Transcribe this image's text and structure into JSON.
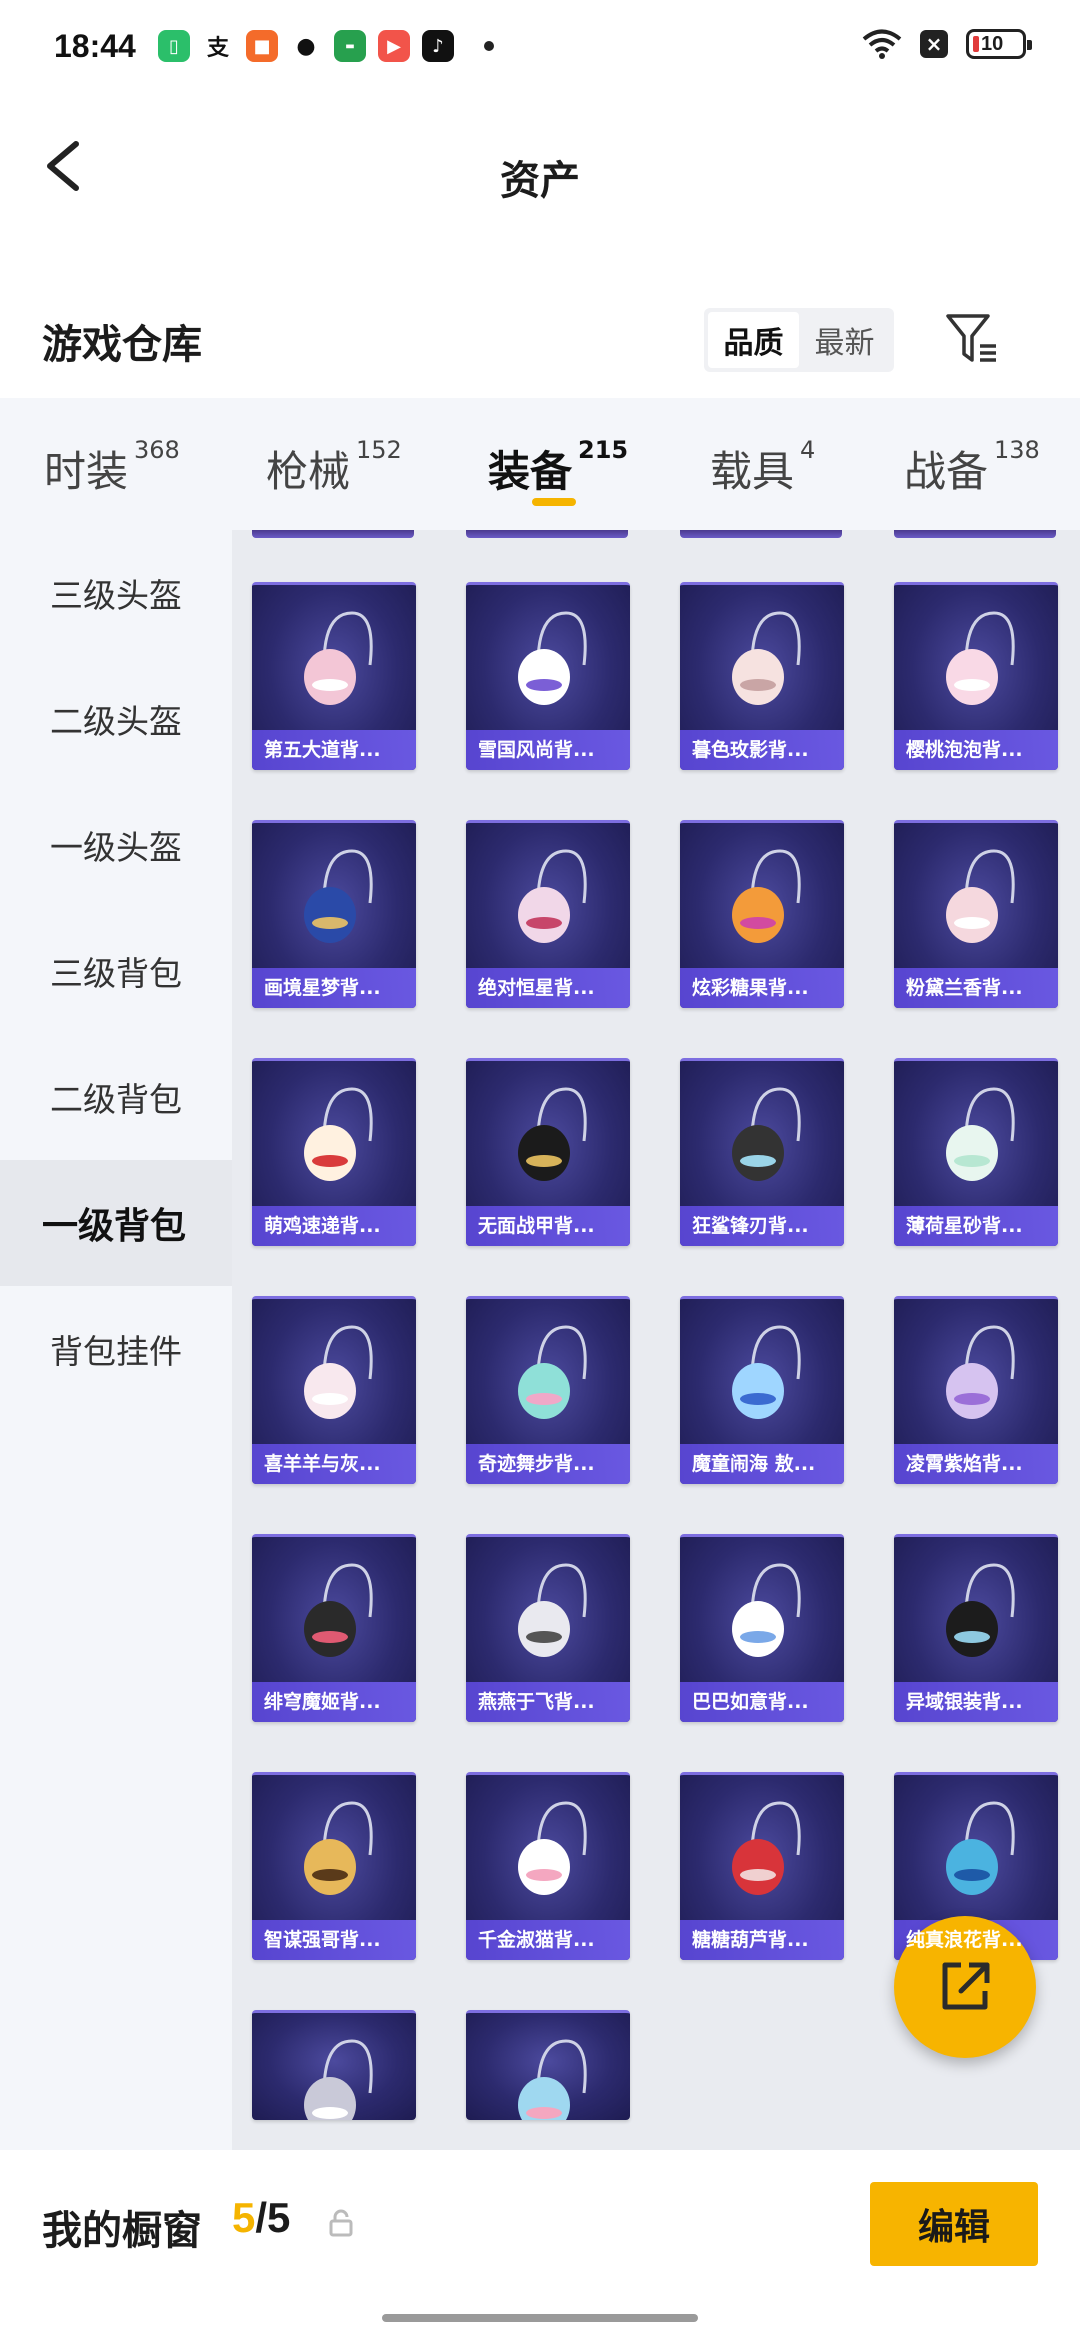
{
  "status_bar": {
    "time": "18:44",
    "battery": "10",
    "apps": [
      "wallet-app",
      "alipay-app",
      "game-app",
      "wechat-app",
      "oppo-app",
      "video-app",
      "tiktok-app"
    ]
  },
  "nav": {
    "title": "资产"
  },
  "warehouse": {
    "title": "游戏仓库",
    "sort_options": [
      "品质",
      "最新"
    ],
    "active_sort": "品质"
  },
  "tabs": [
    {
      "label": "时装",
      "count": "368"
    },
    {
      "label": "枪械",
      "count": "152"
    },
    {
      "label": "装备",
      "count": "215"
    },
    {
      "label": "载具",
      "count": "4"
    },
    {
      "label": "战备",
      "count": "138"
    }
  ],
  "active_tab": "装备",
  "sidebar": [
    "三级头盔",
    "二级头盔",
    "一级头盔",
    "三级背包",
    "二级背包",
    "一级背包",
    "背包挂件"
  ],
  "active_sidebar": "一级背包",
  "items": [
    "第五大道背...",
    "雪国风尚背...",
    "暮色玫影背...",
    "樱桃泡泡背...",
    "画境星梦背...",
    "绝对恒星背...",
    "炫彩糖果背...",
    "粉黛兰香背...",
    "萌鸡速递背...",
    "无面战甲背...",
    "狂鲨锋刃背...",
    "薄荷星砂背...",
    "喜羊羊与灰...",
    "奇迹舞步背...",
    "魔童闹海 敖...",
    "凌霄紫焰背...",
    "绯穹魔姬背...",
    "燕燕于飞背...",
    "巴巴如意背...",
    "异域银装背...",
    "智谋强哥背...",
    "千金淑猫背...",
    "糖糖葫芦背...",
    "纯真浪花背...",
    "",
    ""
  ],
  "bottom_bar": {
    "title": "我的橱窗",
    "current": "5",
    "separator": "/",
    "total": "5",
    "edit_label": "编辑"
  },
  "colors": {
    "accent": "#f7b400",
    "card_bg": "#2c2a6e",
    "card_label_bg": "#5a47d6"
  }
}
